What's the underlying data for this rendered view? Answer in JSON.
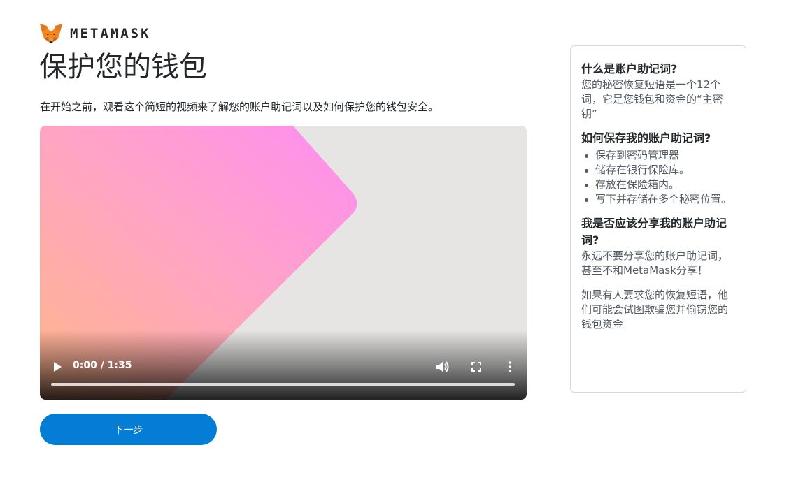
{
  "brand": {
    "name": "METAMASK"
  },
  "header": {
    "title": "保护您的钱包",
    "intro": "在开始之前，观看这个简短的视频来了解您的账户助记词以及如何保护您的钱包安全。"
  },
  "video": {
    "time": "0:00 / 1:35",
    "progress": 0
  },
  "actions": {
    "next_label": "下一步"
  },
  "side_panel": {
    "q1": {
      "title": "什么是账户助记词?",
      "body": "您的秘密恢复短语是一个12个词，它是您钱包和资金的“主密钥”"
    },
    "q2": {
      "title": "如何保存我的账户助记词?",
      "items": [
        "保存到密码管理器",
        "储存在银行保险库。",
        "存放在保险箱内。",
        "写下并存储在多个秘密位置。"
      ]
    },
    "q3": {
      "title": "我是否应该分享我的账户助记词?",
      "body": "永远不要分享您的账户助记词，甚至不和MetaMask分享！",
      "note": "如果有人要求您的恢复短语，他们可能会试图欺骗您并偷窃您的钱包资金"
    }
  },
  "colors": {
    "accent": "#037dd6",
    "text": "#24272a",
    "muted": "#535a61",
    "border": "#d6d9dc"
  }
}
